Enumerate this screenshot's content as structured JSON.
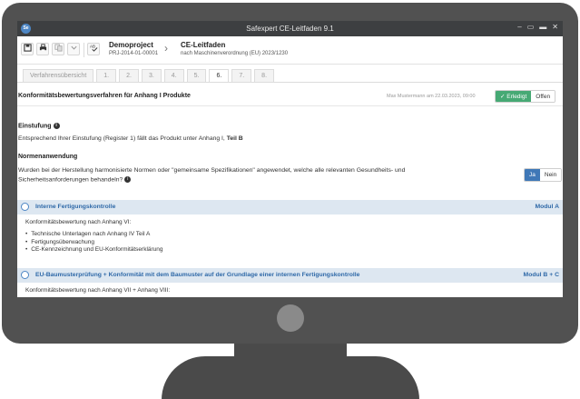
{
  "window": {
    "app_logo": "Se",
    "title": "Safexpert CE-Leitfaden 9.1",
    "controls": [
      "‒",
      "▭",
      "▬",
      "✕"
    ]
  },
  "toolbar": {
    "icons": [
      "save-icon",
      "print-icon",
      "copy-icon",
      "dropdown-icon",
      "spellcheck-icon"
    ],
    "project_name": "Demoproject",
    "project_id": "PRJ-2014-01-00001",
    "guide_title": "CE-Leitfaden",
    "guide_subtitle": "nach Maschinenverordnung (EU) 2023/1230"
  },
  "tabs": [
    {
      "label": "Verfahrensübersicht",
      "active": false
    },
    {
      "label": "1.",
      "active": false
    },
    {
      "label": "2.",
      "active": false
    },
    {
      "label": "3.",
      "active": false
    },
    {
      "label": "4.",
      "active": false
    },
    {
      "label": "5.",
      "active": false
    },
    {
      "label": "6.",
      "active": true
    },
    {
      "label": "7.",
      "active": false
    },
    {
      "label": "8.",
      "active": false
    }
  ],
  "header": {
    "title": "Konformitätsbewertungsverfahren für Anhang I Produkte",
    "meta": "Max Mustermann am 22.03.2023, 09:00",
    "status_done": "✓ Erledigt",
    "status_open": "Offen"
  },
  "classification": {
    "label": "Einstufung",
    "text_prefix": "Entsprechend Ihrer Einstufung (Register 1) fällt das Produkt unter Anhang I,",
    "text_bold": "Teil B"
  },
  "standards": {
    "label": "Normenanwendung",
    "question_line1": "Wurden bei der Herstellung harmonisierte Normen oder \"gemeinsame Spezifikationen\" angewendet, welche alle relevanten Gesundheits- und",
    "question_line2": "Sicherheitsanforderungen behandeln?",
    "yes": "Ja",
    "no": "Nein"
  },
  "options": [
    {
      "title": "Interne Fertigungskontrolle",
      "modul": "Modul A",
      "intro": "Konformitätsbewertung nach Anhang VI:",
      "items": [
        "Technische Unterlagen nach Anhang IV Teil A",
        "Fertigungsüberwachung",
        "CE-Kennzeichnung und EU-Konformitätserklärung"
      ]
    },
    {
      "title": "EU-Baumusterprüfung + Konformität mit dem Baumuster auf der Grundlage einer internen Fertigungskontrolle",
      "modul": "Modul B + C",
      "intro": "Konformitätsbewertung nach Anhang VII + Anhang VIII:"
    }
  ],
  "colors": {
    "accent_blue": "#2f69a8",
    "success_green": "#46a974",
    "option_bar": "#dde7f1",
    "monitor": "#515151"
  }
}
